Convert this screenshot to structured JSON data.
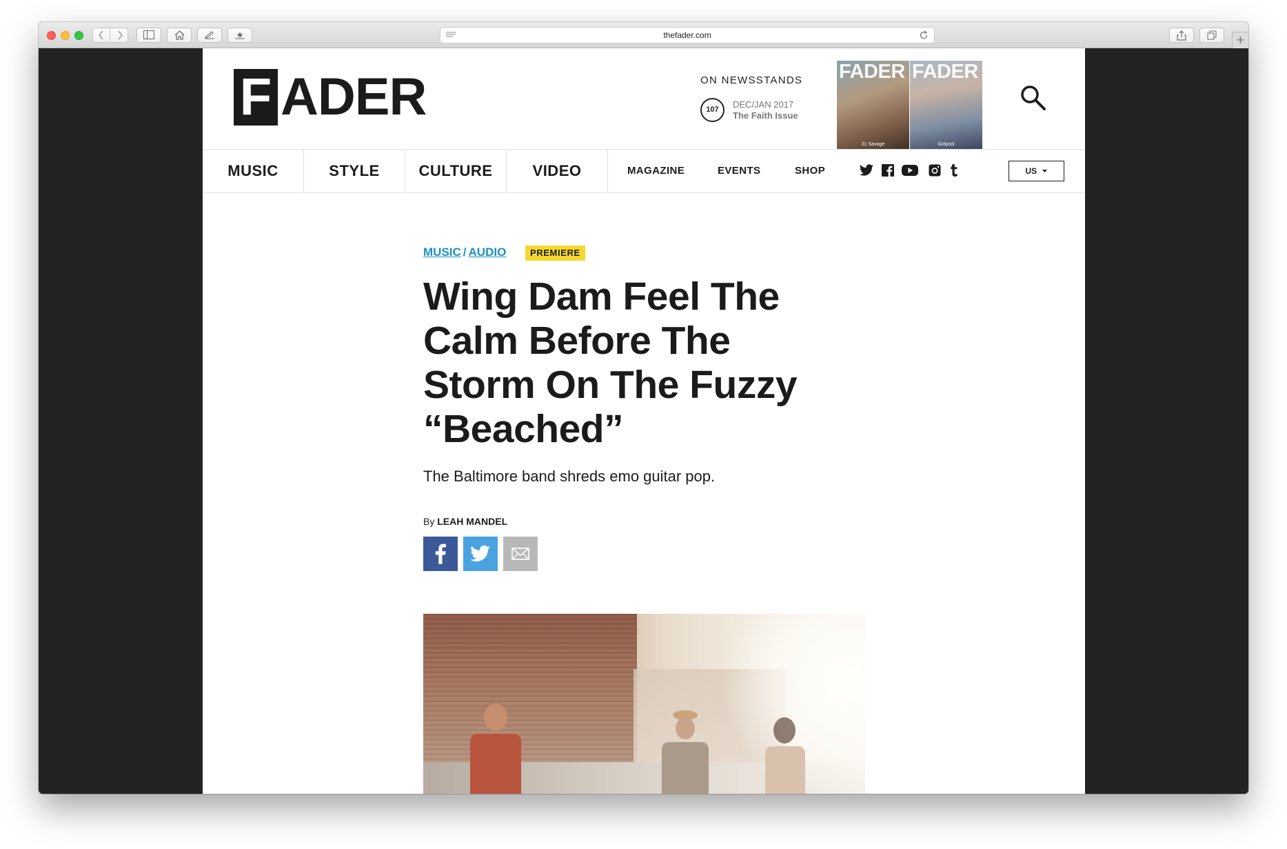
{
  "browser": {
    "url": "thefader.com",
    "new_tab_symbol": "+"
  },
  "site": {
    "logo_box_letter": "F",
    "logo_rest": "ADER",
    "newsstand_label": "ON NEWSSTANDS",
    "issue_number": "107",
    "issue_date": "DEC/JAN 2017",
    "issue_name": "The Faith Issue",
    "covers": [
      {
        "masthead": "FADER",
        "cover_name": "21 Savage"
      },
      {
        "masthead": "FADER",
        "cover_name": "Girlpool"
      }
    ]
  },
  "nav": {
    "primary": [
      "MUSIC",
      "STYLE",
      "CULTURE",
      "VIDEO"
    ],
    "secondary": [
      "MAGAZINE",
      "EVENTS",
      "SHOP"
    ],
    "social_icons": [
      "twitter-icon",
      "facebook-icon",
      "youtube-icon",
      "instagram-icon",
      "tumblr-icon"
    ],
    "region_label": "US"
  },
  "article": {
    "category_1": "MUSIC",
    "separator": "/",
    "category_2": "AUDIO",
    "badge": "PREMIERE",
    "headline": "Wing Dam Feel The Calm Before The Storm On The Fuzzy “Beached”",
    "dek": "The Baltimore band shreds emo guitar pop.",
    "byline_prefix": "By",
    "author": "LEAH MANDEL",
    "share_icons": [
      "facebook-icon",
      "twitter-icon",
      "email-icon"
    ]
  },
  "colors": {
    "link_blue": "#1a8fc6",
    "badge_yellow": "#f5d82e",
    "facebook_blue": "#3b5998",
    "twitter_blue": "#4aa3df",
    "email_gray": "#b8b8b8",
    "window_dark": "#232323"
  }
}
